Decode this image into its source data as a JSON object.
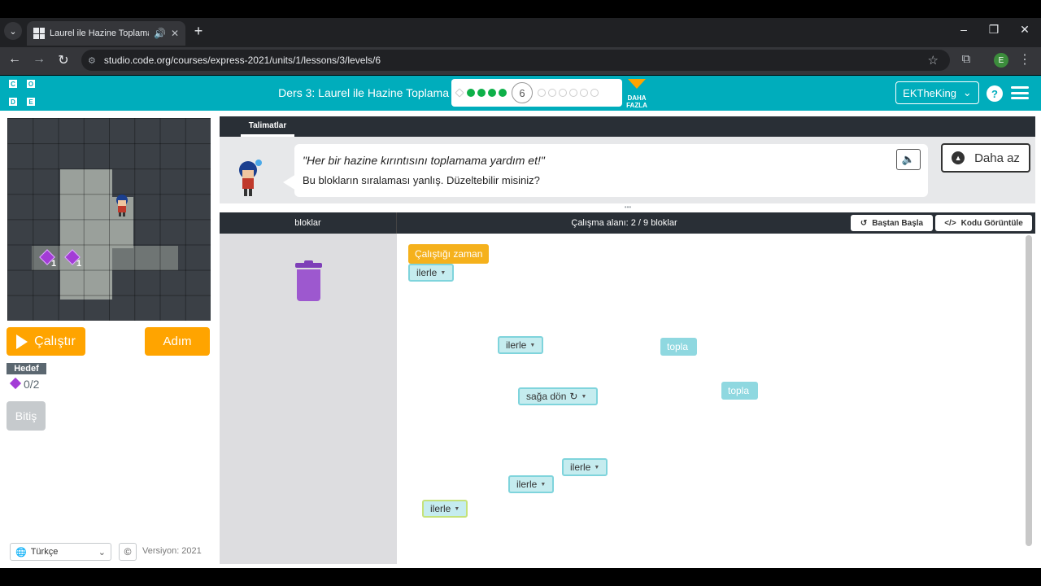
{
  "browser": {
    "tab_title": "Laurel ile Hazine Toplama #",
    "url": "studio.code.org/courses/express-2021/units/1/lessons/3/levels/6",
    "profile_initial": "E"
  },
  "header": {
    "logo_letters": [
      "C",
      "O",
      "D",
      "E"
    ],
    "lesson_title": "Ders 3: Laurel ile Hazine Toplama",
    "current_level": "6",
    "progress": {
      "completed_before_current": 4,
      "remaining_after_current": 6,
      "has_diamond_start": true
    },
    "more_label": "DAHA FAZLA",
    "username": "EKTheKing",
    "colors": {
      "brand": "#00adbc",
      "accent": "#ffa400",
      "done": "#0eb049"
    }
  },
  "game": {
    "gem_counts": [
      "1",
      "1"
    ],
    "run_label": "Çalıştır",
    "step_label": "Adım",
    "goal_label": "Hedef",
    "goal_progress": "0/2",
    "finish_label": "Bitiş"
  },
  "footer": {
    "language": "Türkçe",
    "copyright_icon": "©",
    "version": "Versiyon: 2021"
  },
  "instructions": {
    "tab": "Talimatlar",
    "line1": "\"Her bir hazine kırıntısını toplamama yardım et!\"",
    "line2": "Bu blokların sıralaması yanlış. Düzeltebilir misiniz?",
    "less_label": "Daha az"
  },
  "workspace": {
    "toolbox_label": "bloklar",
    "count_label": "Çalışma alanı: 2 / 9 bloklar",
    "reset_label": "Baştan Başla",
    "code_label": "Kodu Görüntüle",
    "blocks": {
      "event": "Çalıştığı zaman",
      "attached_move": "ilerle",
      "move_1": "ilerle",
      "move_2": "ilerle",
      "move_3": "ilerle",
      "move_4": "ilerle",
      "turn": "sağa dön",
      "collect_1": "topla",
      "collect_2": "topla"
    }
  }
}
